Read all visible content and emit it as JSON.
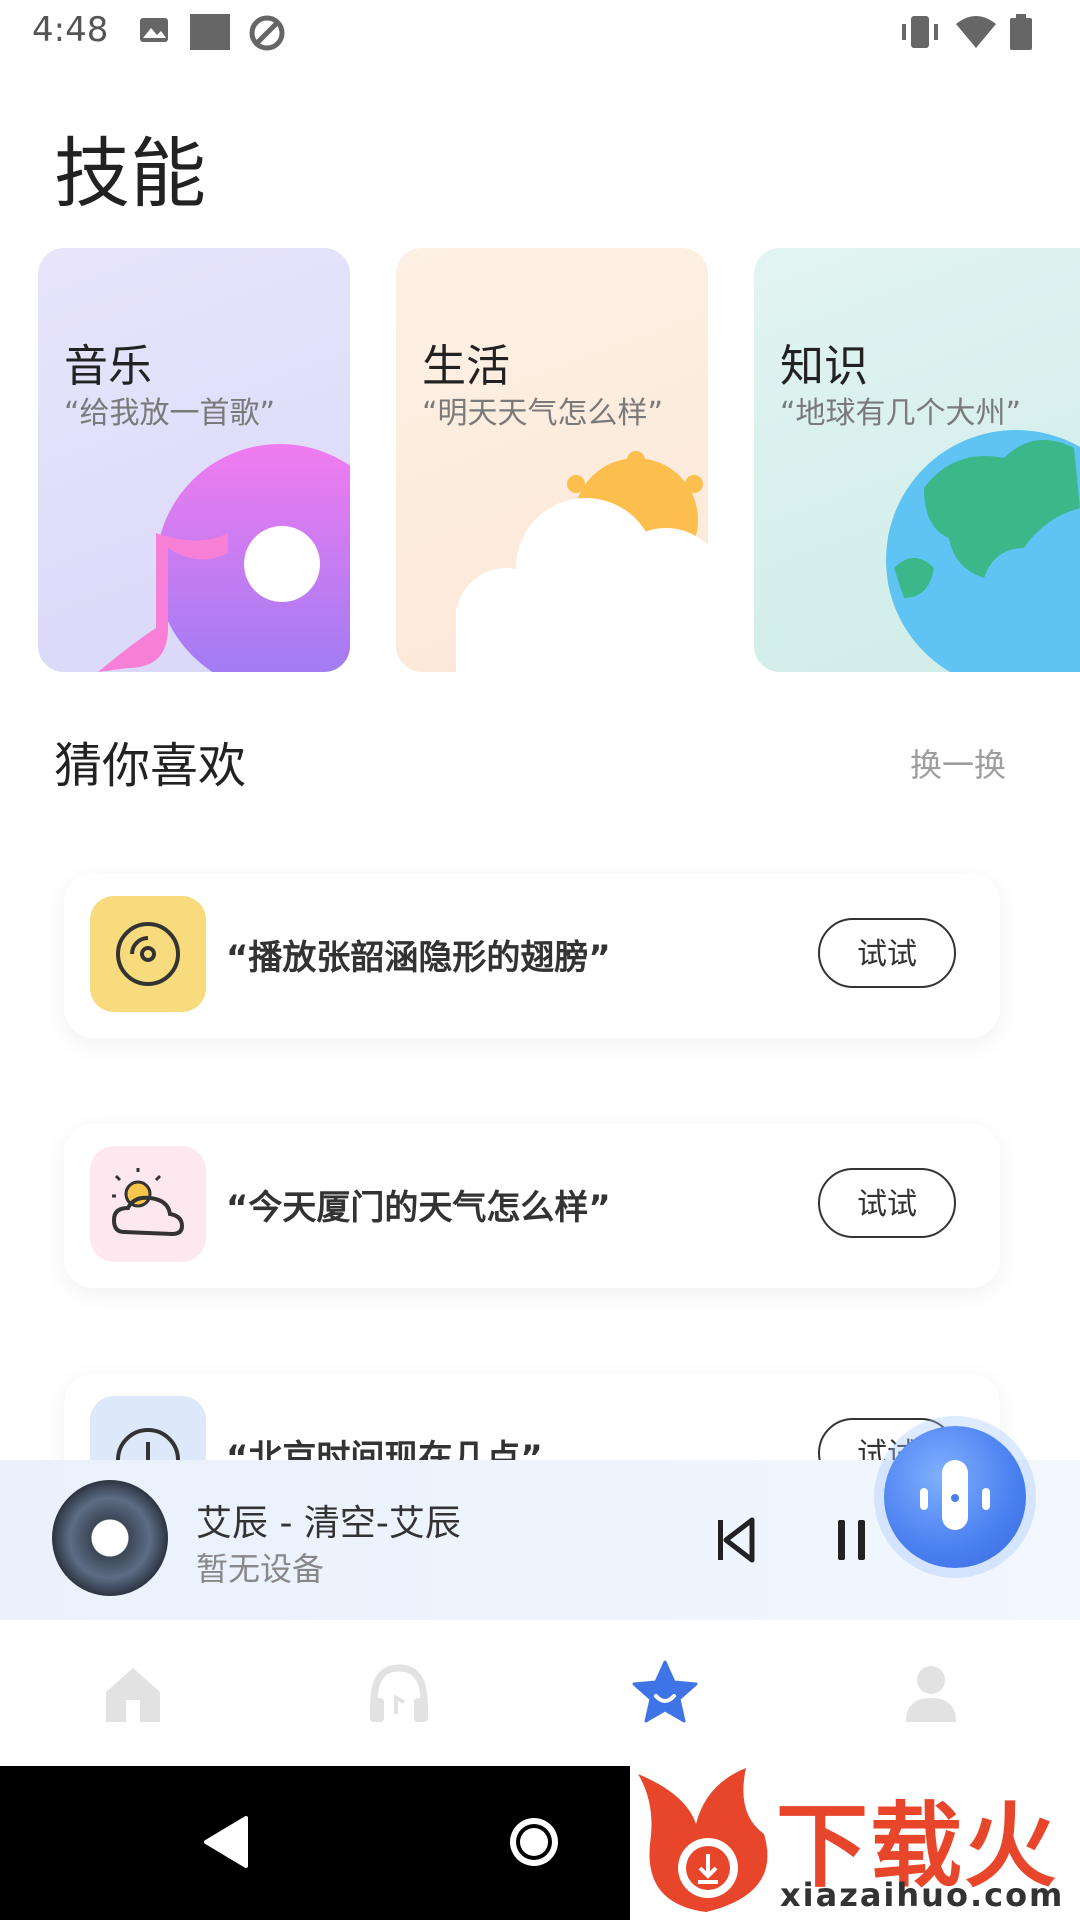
{
  "status_bar": {
    "time": "4:48"
  },
  "page": {
    "title": "技能"
  },
  "skills": [
    {
      "title": "音乐",
      "example": "“给我放一首歌”",
      "icon": "music-disc-icon"
    },
    {
      "title": "生活",
      "example": "“明天天气怎么样”",
      "icon": "sun-cloud-icon"
    },
    {
      "title": "知识",
      "example": "“地球有几个大州”",
      "icon": "globe-icon"
    }
  ],
  "recommend": {
    "title": "猜你喜欢",
    "refresh_label": "换一换",
    "items": [
      {
        "text": "“播放张韶涵隐形的翅膀”",
        "button": "试试",
        "icon": "disc-icon"
      },
      {
        "text": "“今天厦门的天气怎么样”",
        "button": "试试",
        "icon": "weather-icon"
      },
      {
        "text": "“北京时间现在几点”",
        "button": "试试",
        "icon": "clock-icon"
      }
    ]
  },
  "player": {
    "song": "艾辰 - 清空-艾辰",
    "device": "暂无设备"
  },
  "tabs": [
    "home-icon",
    "headphones-icon",
    "star-icon",
    "profile-icon"
  ],
  "watermark": {
    "text": "下载火",
    "url": "xiazaihuo.com"
  },
  "colors": {
    "accent": "#3f74e6",
    "music_bg": "#e5e3fb",
    "life_bg": "#fdeedd",
    "knowledge_bg": "#d9f0ee"
  }
}
